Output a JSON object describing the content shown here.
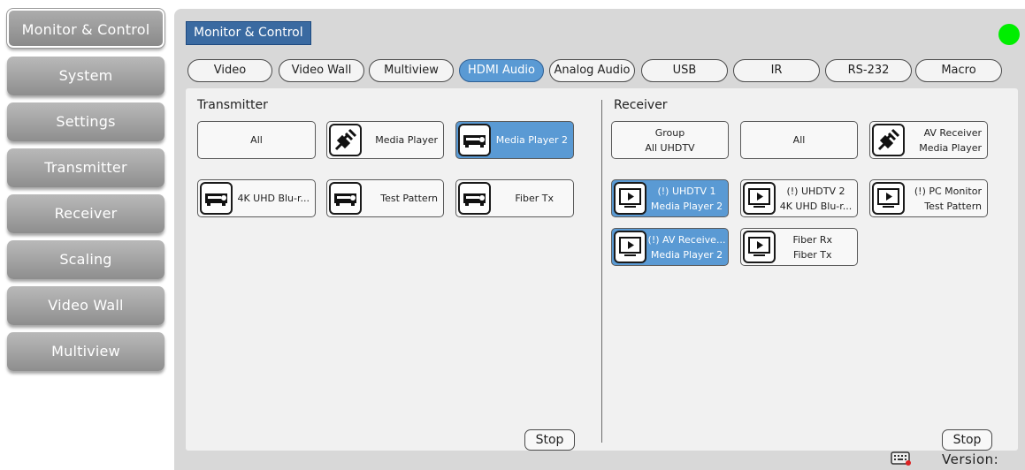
{
  "sidebar": {
    "items": [
      {
        "label": "Monitor & Control",
        "active": true
      },
      {
        "label": "System"
      },
      {
        "label": "Settings"
      },
      {
        "label": "Transmitter"
      },
      {
        "label": "Receiver"
      },
      {
        "label": "Scaling"
      },
      {
        "label": "Video Wall"
      },
      {
        "label": "Multiview"
      }
    ]
  },
  "header": {
    "title": "Monitor & Control",
    "status_color": "#00ee00"
  },
  "tabs": [
    {
      "label": "Video"
    },
    {
      "label": "Video Wall"
    },
    {
      "label": "Multiview"
    },
    {
      "label": "HDMI Audio",
      "active": true
    },
    {
      "label": "Analog Audio"
    },
    {
      "label": "USB"
    },
    {
      "label": "IR"
    },
    {
      "label": "RS-232"
    },
    {
      "label": "Macro"
    }
  ],
  "transmitter": {
    "label": "Transmitter",
    "devices": [
      {
        "line1": "All",
        "icon": "none"
      },
      {
        "line1": "Media Player",
        "icon": "disconnected-plug-icon"
      },
      {
        "line1": "Media Player 2",
        "icon": "projector-icon",
        "selected": true
      },
      {
        "line1": "4K UHD Blu-r...",
        "icon": "projector-icon"
      },
      {
        "line1": "Test Pattern",
        "icon": "projector-icon"
      },
      {
        "line1": "Fiber Tx",
        "icon": "projector-icon"
      }
    ],
    "stop_label": "Stop"
  },
  "receiver": {
    "label": "Receiver",
    "devices": [
      {
        "line1": "Group",
        "line2": "All UHDTV",
        "icon": "none"
      },
      {
        "line1": "All",
        "icon": "none"
      },
      {
        "line1": "AV Receiver",
        "line2": "Media Player",
        "icon": "disconnected-plug-icon"
      },
      {
        "line1": "(!) UHDTV 1",
        "line2": "Media Player 2",
        "icon": "display-icon",
        "selected": true
      },
      {
        "line1": "(!) UHDTV 2",
        "line2": "4K UHD Blu-r...",
        "icon": "display-icon"
      },
      {
        "line1": "(!) PC Monitor",
        "line2": "Test Pattern",
        "icon": "display-icon"
      },
      {
        "line1": "(!) AV Receive...",
        "line2": "Media Player 2",
        "icon": "display-icon",
        "selected": true
      },
      {
        "line1": "Fiber Rx",
        "line2": "Fiber Tx",
        "icon": "display-icon"
      }
    ],
    "stop_label": "Stop"
  },
  "footer": {
    "version_label": "Version:",
    "icon": "keyboard-icon"
  }
}
